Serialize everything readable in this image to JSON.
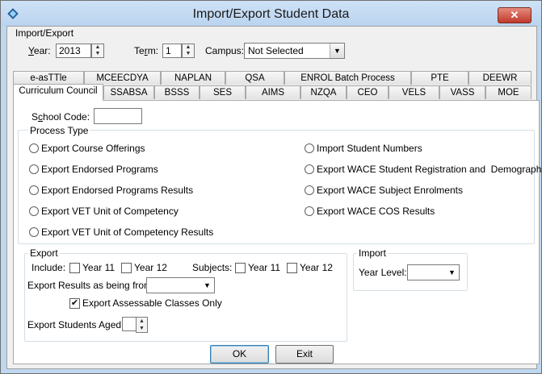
{
  "window": {
    "title": "Import/Export Student Data",
    "close_symbol": "✕"
  },
  "top_group": {
    "label": "Import/Export",
    "year_label": "Year:",
    "year_value": "2013",
    "term_label": "Term:",
    "term_value": "1",
    "campus_label": "Campus:",
    "campus_value": "Not Selected"
  },
  "tabs_row1": [
    "e-asTTle",
    "MCEECDYA",
    "NAPLAN",
    "QSA",
    "ENROL Batch Process",
    "PTE",
    "DEEWR"
  ],
  "tabs_row2": [
    "Curriculum Council",
    "SSABSA",
    "BSSS",
    "SES",
    "AIMS",
    "NZQA",
    "CEO",
    "VELS",
    "VASS",
    "MOE"
  ],
  "panel": {
    "school_code_label": "School Code:",
    "school_code_value": "",
    "process_type_label": "Process Type",
    "radios_left": [
      "Export Course Offerings",
      "Export Endorsed Programs",
      "Export Endorsed Programs Results",
      "Export VET Unit of Competency",
      "Export VET Unit of Competency Results"
    ],
    "radios_right": [
      "Import Student Numbers",
      "Export WACE Student Registration and  Demographic",
      "Export WACE Subject Enrolments",
      "Export WACE COS Results"
    ],
    "export": {
      "label": "Export",
      "include_label": "Include:",
      "year11": "Year 11",
      "year12": "Year 12",
      "subjects_label": "Subjects:",
      "subj_year11": "Year 11",
      "subj_year12": "Year 12",
      "results_from_label": "Export Results as being from:",
      "results_from_value": "",
      "assessable_label": "Export Assessable Classes Only",
      "assessable_checked": true,
      "students_aged_label": "Export Students Aged:",
      "students_aged_value": ""
    },
    "import": {
      "label": "Import",
      "year_level_label": "Year Level:",
      "year_level_value": ""
    }
  },
  "buttons": {
    "ok": "OK",
    "exit": "Exit"
  },
  "colors": {
    "title_bar": "#bfd7ef",
    "client_bg": "#f0f0f0",
    "close_button": "#c0392b"
  }
}
